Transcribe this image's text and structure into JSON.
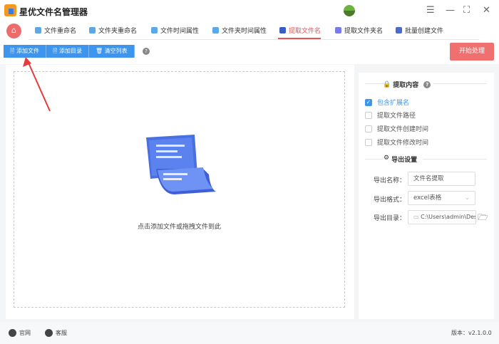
{
  "app": {
    "title": "星优文件名管理器"
  },
  "window_controls": [
    "settings-icon",
    "minimize-icon",
    "maximize-icon",
    "close-icon"
  ],
  "tabs": [
    {
      "label": "文件重命名",
      "active": false
    },
    {
      "label": "文件夹重命名",
      "active": false
    },
    {
      "label": "文件时间属性",
      "active": false
    },
    {
      "label": "文件夹时间属性",
      "active": false
    },
    {
      "label": "提取文件名",
      "active": true
    },
    {
      "label": "提取文件夹名",
      "active": false
    },
    {
      "label": "批量创建文件",
      "active": false
    }
  ],
  "toolbar": {
    "add_file": "添加文件",
    "add_dir": "添加目录",
    "clear_list": "清空列表",
    "start": "开始处理"
  },
  "dropzone": {
    "hint": "点击添加文件或拖拽文件到此"
  },
  "extract": {
    "title": "提取内容",
    "options": [
      {
        "label": "包含扩展名",
        "checked": true
      },
      {
        "label": "提取文件路径",
        "checked": false
      },
      {
        "label": "提取文件创建时间",
        "checked": false
      },
      {
        "label": "提取文件修改时间",
        "checked": false
      }
    ]
  },
  "export": {
    "title": "导出设置",
    "name_label": "导出名称：",
    "name_value": "文件名提取",
    "format_label": "导出格式：",
    "format_value": "excel表格",
    "dir_label": "导出目录：",
    "dir_value": "C:\\Users\\admin\\Des"
  },
  "footer": {
    "website": "官网",
    "service": "客服",
    "version": "版本：v2.1.0.0"
  },
  "colors": {
    "accent": "#3d95ee",
    "active_tab": "#e0545a",
    "start_button": "#f07070"
  }
}
